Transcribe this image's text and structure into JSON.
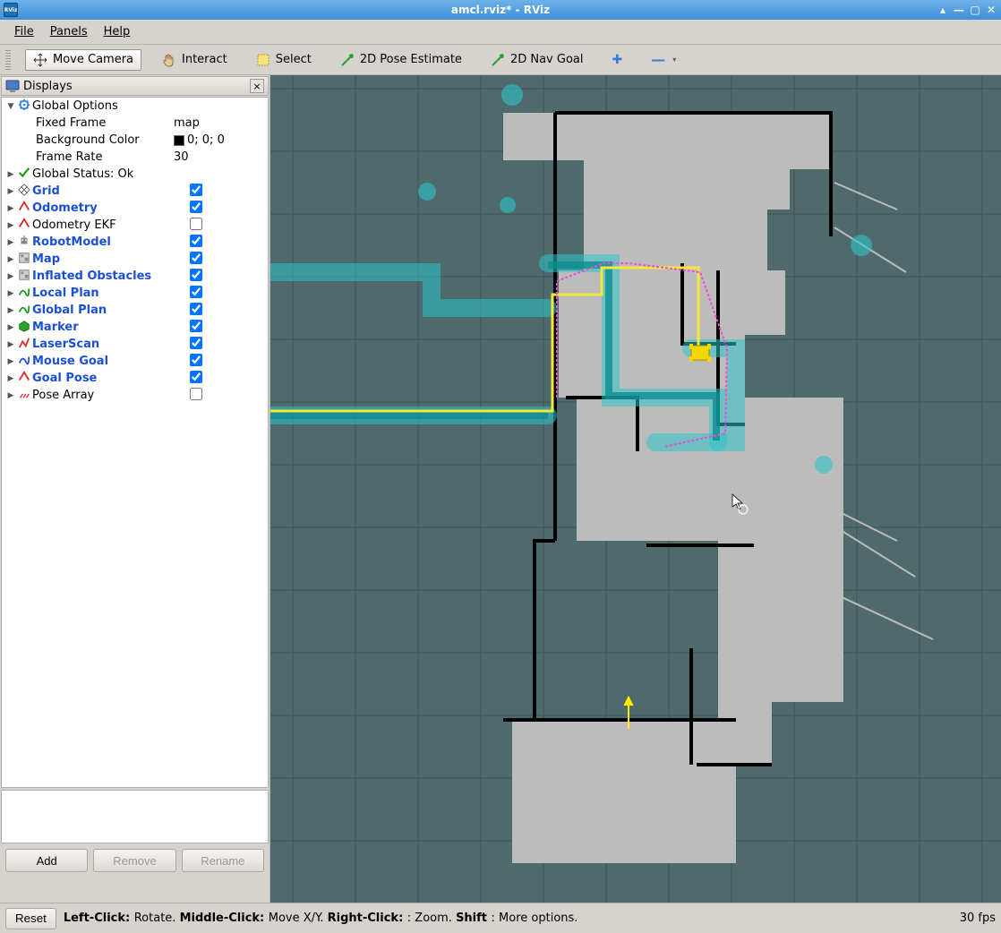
{
  "window": {
    "title": "amcl.rviz* - RViz",
    "app_abbrev": "RViz"
  },
  "menu": {
    "file": "File",
    "panels": "Panels",
    "help": "Help"
  },
  "toolbar": {
    "move_camera": "Move Camera",
    "interact": "Interact",
    "select": "Select",
    "pose_estimate": "2D Pose Estimate",
    "nav_goal": "2D Nav Goal"
  },
  "displays": {
    "title": "Displays",
    "global_options": {
      "label": "Global Options",
      "fixed_frame": {
        "label": "Fixed Frame",
        "value": "map"
      },
      "background_color": {
        "label": "Background Color",
        "value": "0; 0; 0"
      },
      "frame_rate": {
        "label": "Frame Rate",
        "value": "30"
      }
    },
    "items": [
      {
        "label": "Global Status: Ok",
        "icon": "check",
        "link": false,
        "checkbox": null
      },
      {
        "label": "Grid",
        "icon": "grid",
        "link": true,
        "checkbox": true
      },
      {
        "label": "Odometry",
        "icon": "odom-red",
        "link": true,
        "checkbox": true
      },
      {
        "label": "Odometry EKF",
        "icon": "odom-red",
        "link": false,
        "checkbox": false
      },
      {
        "label": "RobotModel",
        "icon": "robot",
        "link": true,
        "checkbox": true
      },
      {
        "label": "Map",
        "icon": "map",
        "link": true,
        "checkbox": true
      },
      {
        "label": "Inflated Obstacles",
        "icon": "map",
        "link": true,
        "checkbox": true
      },
      {
        "label": "Local Plan",
        "icon": "path-green",
        "link": true,
        "checkbox": true
      },
      {
        "label": "Global Plan",
        "icon": "path-green",
        "link": true,
        "checkbox": true
      },
      {
        "label": "Marker",
        "icon": "marker",
        "link": true,
        "checkbox": true
      },
      {
        "label": "LaserScan",
        "icon": "laser",
        "link": true,
        "checkbox": true
      },
      {
        "label": "Mouse Goal",
        "icon": "path-blue",
        "link": true,
        "checkbox": true
      },
      {
        "label": "Goal Pose",
        "icon": "odom-red",
        "link": true,
        "checkbox": true
      },
      {
        "label": "Pose Array",
        "icon": "posearray",
        "link": false,
        "checkbox": false
      }
    ],
    "buttons": {
      "add": "Add",
      "remove": "Remove",
      "rename": "Rename"
    }
  },
  "status": {
    "reset": "Reset",
    "hints_html": "Left-Click:|Rotate.|Middle-Click:|Move X/Y.|Right-Click:|: Zoom.|Shift|: More options.",
    "fps": "30 fps"
  },
  "colors": {
    "viewport_bg": "#4e6a6c",
    "grid": "#3c5456",
    "map_free": "#bcbcbc",
    "map_wall": "#000000",
    "inflation": "#2ec3c8",
    "inflation_dark": "#0c8c90",
    "path_yellow": "#f5e838",
    "path_magenta": "#f24bd8",
    "robot": "#f5d800",
    "goal_arrow": "#ffee00"
  }
}
